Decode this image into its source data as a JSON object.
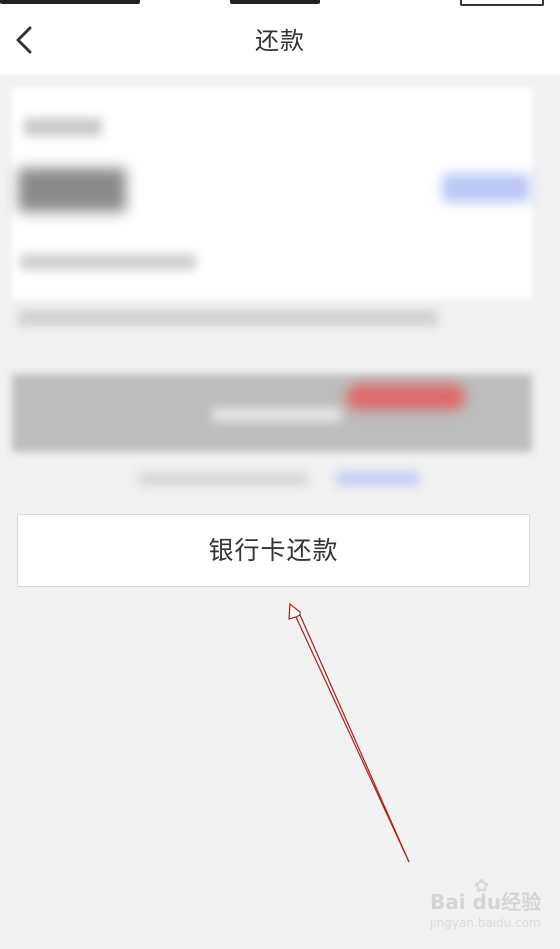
{
  "nav": {
    "title": "还款",
    "back_icon": "chevron-left-icon"
  },
  "actions": {
    "bank_card_repay_label": "银行卡还款"
  },
  "watermark": {
    "logo_text": "Bai du经验",
    "url": "jingyan.baidu.com"
  },
  "colors": {
    "arrow": "#b01c1c",
    "background": "#f2f2f2",
    "card": "#ffffff",
    "text": "#333333"
  }
}
